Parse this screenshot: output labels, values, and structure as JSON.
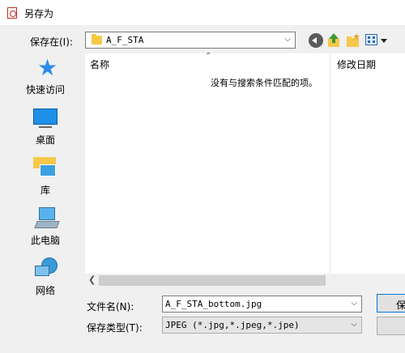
{
  "window": {
    "title": "另存为"
  },
  "toolbar": {
    "save_in_label": "保存在(I):",
    "save_in_value": "A_F_STA",
    "icons": [
      "back-icon",
      "up-folder-icon",
      "new-folder-icon",
      "view-menu-icon"
    ]
  },
  "places": [
    {
      "label": "快速访问",
      "icon": "star-icon"
    },
    {
      "label": "桌面",
      "icon": "desktop-icon"
    },
    {
      "label": "库",
      "icon": "library-icon"
    },
    {
      "label": "此电脑",
      "icon": "computer-icon"
    },
    {
      "label": "网络",
      "icon": "network-icon"
    }
  ],
  "filelist": {
    "columns": [
      "名称",
      "修改日期"
    ],
    "empty_message": "没有与搜索条件匹配的项。"
  },
  "filename": {
    "label": "文件名(N):",
    "value": "A_F_STA_bottom.jpg"
  },
  "filetype": {
    "label": "保存类型(T):",
    "value": "JPEG (*.jpg,*.jpeg,*.jpe)"
  },
  "buttons": {
    "save": "保"
  },
  "colors": {
    "accent": "#0078d7",
    "folder": "#f6c84a",
    "star": "#2d8be8"
  }
}
